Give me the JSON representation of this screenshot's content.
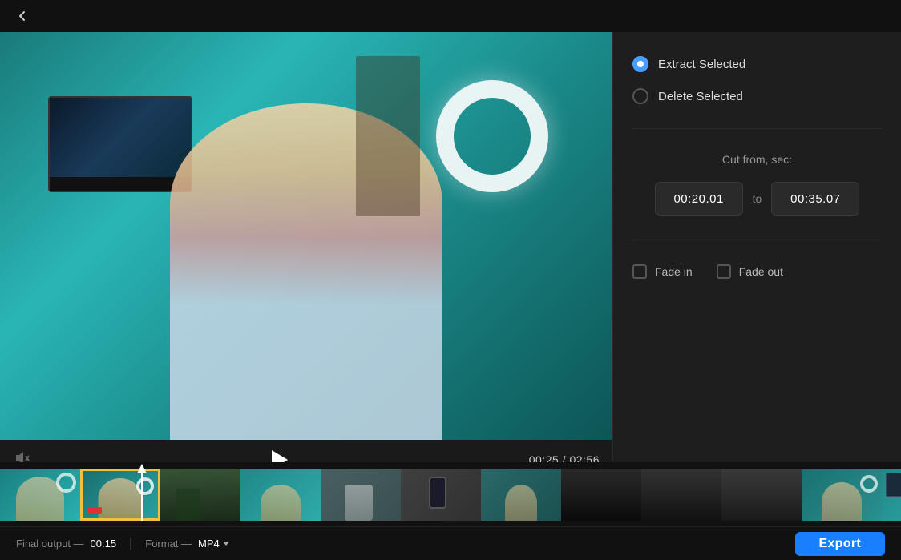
{
  "topbar": {
    "back_icon": "←"
  },
  "video": {
    "current_time": "00:25",
    "total_time": "02:56"
  },
  "rightPanel": {
    "extract_selected_label": "Extract Selected",
    "delete_selected_label": "Delete Selected",
    "cut_from_label": "Cut from, sec:",
    "cut_from_value": "00:20.01",
    "cut_to_value": "00:35.07",
    "to_label": "to",
    "fade_in_label": "Fade in",
    "fade_out_label": "Fade out"
  },
  "bottomBar": {
    "final_output_label": "Final output —",
    "final_output_value": "00:15",
    "format_label": "Format —",
    "format_value": "MP4",
    "export_label": "Export"
  },
  "timeline": {
    "thumbs": [
      {
        "color": "#2a8080",
        "accent": "#3a9090"
      },
      {
        "color": "#1e6060",
        "accent": "#2a7a7a"
      },
      {
        "color": "#222",
        "accent": "#333"
      },
      {
        "color": "#2a8080",
        "accent": "#3a9090"
      },
      {
        "color": "#3a3a3a",
        "accent": "#4a4a4a"
      },
      {
        "color": "#404040",
        "accent": "#505050"
      },
      {
        "color": "#2a6060",
        "accent": "#3a7070"
      },
      {
        "color": "#1a4040",
        "accent": "#2a5050"
      },
      {
        "color": "#555",
        "accent": "#666"
      },
      {
        "color": "#444",
        "accent": "#555"
      },
      {
        "color": "#2a7070",
        "accent": "#3a8080"
      },
      {
        "color": "#2a8080",
        "accent": "#3a9090"
      }
    ]
  }
}
